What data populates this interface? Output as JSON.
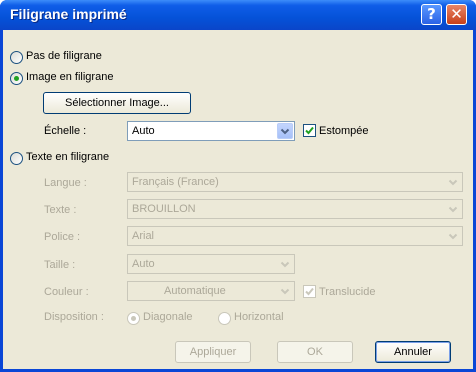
{
  "window": {
    "title": "Filigrane imprimé"
  },
  "titlebar": {
    "help_label": "?",
    "close_label": "✕"
  },
  "options": {
    "no_watermark": "Pas de filigrane",
    "image_watermark": "Image en filigrane",
    "text_watermark": "Texte en filigrane"
  },
  "image_section": {
    "select_button": "Sélectionner Image...",
    "scale_label": "Échelle :",
    "scale_value": "Auto",
    "washout_label": "Estompée",
    "washout_checked": true
  },
  "text_section": {
    "language_label": "Langue :",
    "language_value": "Français (France)",
    "text_label": "Texte :",
    "text_value": "BROUILLON",
    "font_label": "Police :",
    "font_value": "Arial",
    "size_label": "Taille :",
    "size_value": "Auto",
    "color_label": "Couleur :",
    "color_value": "Automatique",
    "translucent_label": "Translucide",
    "layout_label": "Disposition :",
    "diagonal_label": "Diagonale",
    "horizontal_label": "Horizontal"
  },
  "footer": {
    "apply": "Appliquer",
    "ok": "OK",
    "cancel": "Annuler"
  },
  "colors": {
    "title_blue": "#0a46d6",
    "dialog_bg": "#ece9d8",
    "disabled_text": "#aca899"
  }
}
